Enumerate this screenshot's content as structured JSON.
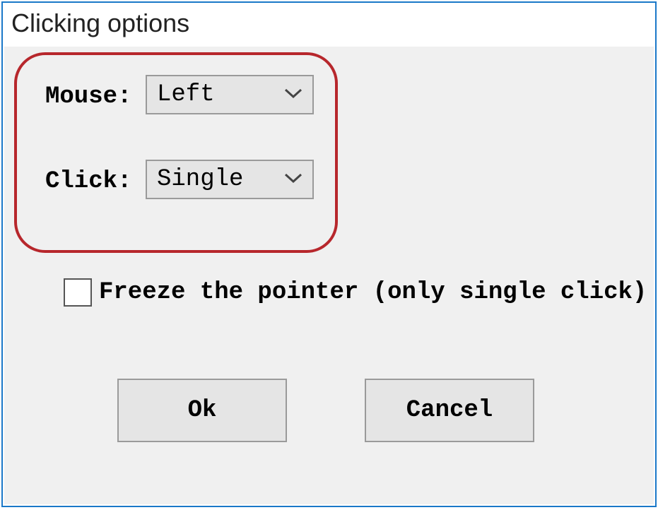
{
  "window": {
    "title": "Clicking options"
  },
  "fields": {
    "mouse": {
      "label": "Mouse:",
      "value": "Left"
    },
    "click": {
      "label": "Click:",
      "value": "Single"
    }
  },
  "checkbox": {
    "label": "Freeze the pointer (only single click)",
    "checked": false
  },
  "buttons": {
    "ok": "Ok",
    "cancel": "Cancel"
  }
}
